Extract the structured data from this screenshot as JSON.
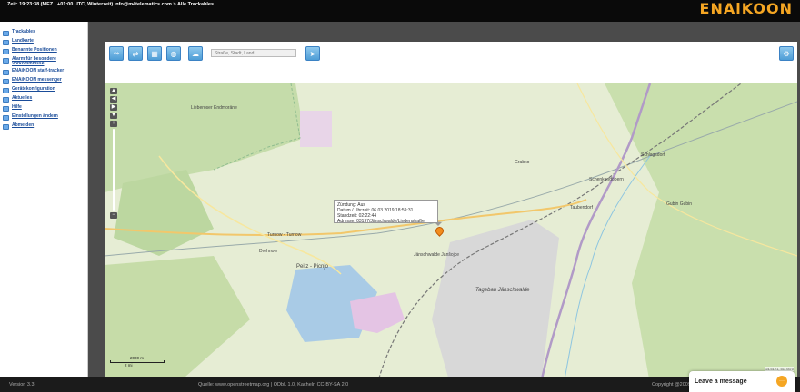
{
  "topbar": {
    "status": "Zeit: 19:23:38 (MEZ : +01:00 UTC, Winterzeit) info@m4telematics.com > Alle Trackables",
    "logo": "ENAiKOON"
  },
  "sidebar": {
    "items": [
      {
        "label": "Trackables"
      },
      {
        "label": "Landkarte"
      },
      {
        "label": "Benannte Positionen"
      },
      {
        "label": "Alarm für besondere Vorkommnisse"
      },
      {
        "label": "ENAiKOON staff-tracker"
      },
      {
        "label": "ENAiKOON messenger"
      },
      {
        "label": "Gerätekonfiguration"
      },
      {
        "label": "Aktuelles"
      },
      {
        "label": "Hilfe"
      },
      {
        "label": "Einstellungen ändern"
      },
      {
        "label": "Abmelden"
      }
    ]
  },
  "toolbar": {
    "search_placeholder": "Straße, Stadt, Land"
  },
  "popup": {
    "line1": "Zündung: Aus",
    "line2": "Datum / Uhrzeit: 06.03.2019 18:59:31",
    "line3": "Standzeit: 02:22:44",
    "line4": "Adresse: 03197/Jänschwalde/Lindenstraße"
  },
  "map_labels": {
    "lieberoser": "Lieberoser Endmoräne",
    "peitz": "Peitz - Picnjo",
    "tagebau": "Tagebau Jänschwalde",
    "drehnow": "Drehnow",
    "turnow": "Turnow - Turnow",
    "jaenschwalde": "Jänschwalde Janšojce",
    "grabko": "Grabko",
    "schenkendoebern": "Schenkendöbern",
    "schlagsdorf": "Schlagsdorf",
    "taubendorf": "Taubendorf",
    "guben": "Gubin Gubin"
  },
  "scale": {
    "km": "2000 m",
    "mi": "2 mi"
  },
  "attribution": "14.5121, 51.7870",
  "footer": {
    "version": "Version 3.3",
    "source_label": "Quelle:",
    "source_link": "www.openstreetmap.org",
    "license": "ODbL 1.0, Kacheln CC-BY-SA 2.0",
    "copyright": "Copyright @2009"
  },
  "chat": {
    "label": "Leave a message"
  }
}
